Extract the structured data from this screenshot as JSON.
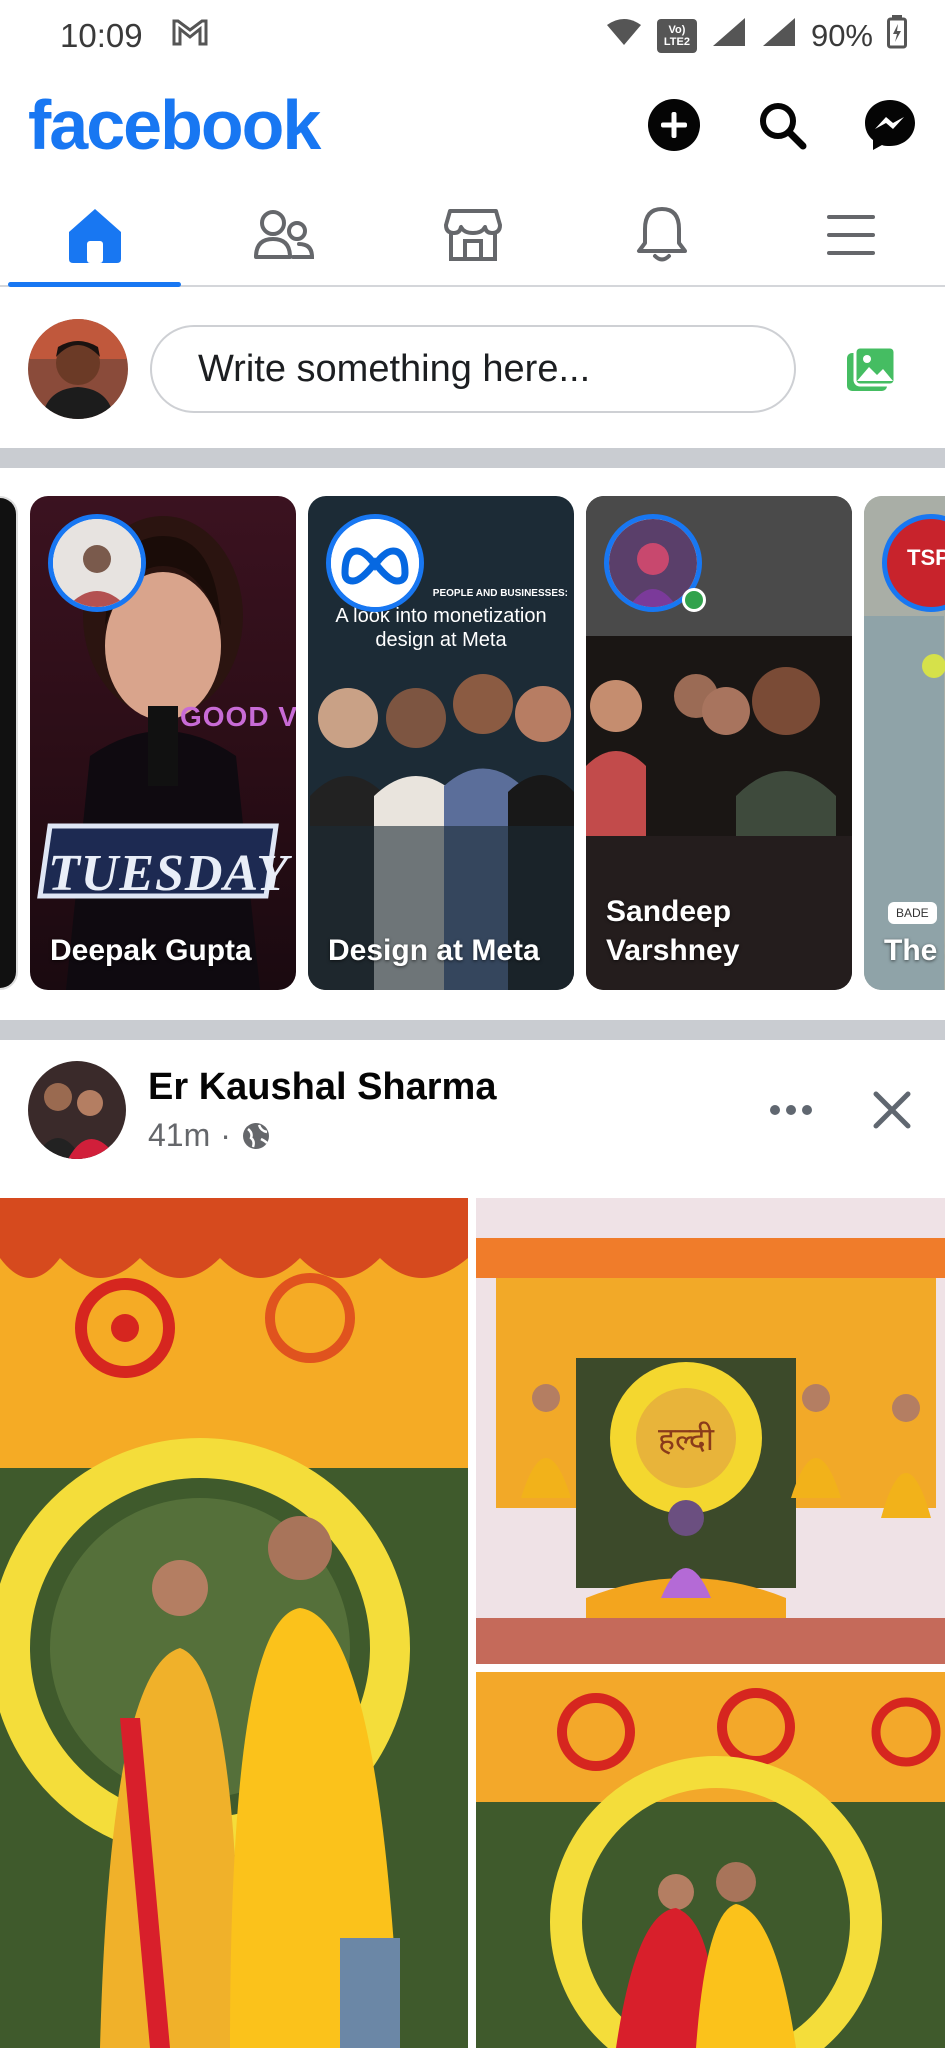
{
  "status_bar": {
    "time": "10:09",
    "network_label_1": "Vo)",
    "network_label_2": "LTE2",
    "battery": "90%"
  },
  "header": {
    "logo": "facebook",
    "actions": [
      {
        "icon": "plus-circle-icon"
      },
      {
        "icon": "search-icon"
      },
      {
        "icon": "messenger-icon"
      }
    ]
  },
  "tabs": [
    {
      "icon": "home-icon",
      "active": true
    },
    {
      "icon": "friends-icon",
      "active": false
    },
    {
      "icon": "marketplace-icon",
      "active": false
    },
    {
      "icon": "bell-icon",
      "active": false
    },
    {
      "icon": "menu-icon",
      "active": false
    }
  ],
  "composer": {
    "placeholder": "Write something here..."
  },
  "stories": [
    {
      "name": "Deepak Gupta",
      "overlay_text": "TUESDAY",
      "badge_text": "GOOD VIBES"
    },
    {
      "name": "Design at Meta",
      "headline_top": "PEOPLE AND BUSINESSES:",
      "headline": "A look into monetization design at Meta"
    },
    {
      "name": "Sandeep Varshney"
    },
    {
      "name": "The S",
      "badge": "TSP",
      "chip": "BADE"
    }
  ],
  "post": {
    "author": "Er Kaushal Sharma",
    "time": "41m",
    "privacy_icon": "globe-icon",
    "image_text": "हल्दी"
  },
  "colors": {
    "brand": "#1877f2",
    "divider": "#c9ccd1",
    "photo_icon": "#45bd62",
    "online_dot": "#31a24c"
  }
}
